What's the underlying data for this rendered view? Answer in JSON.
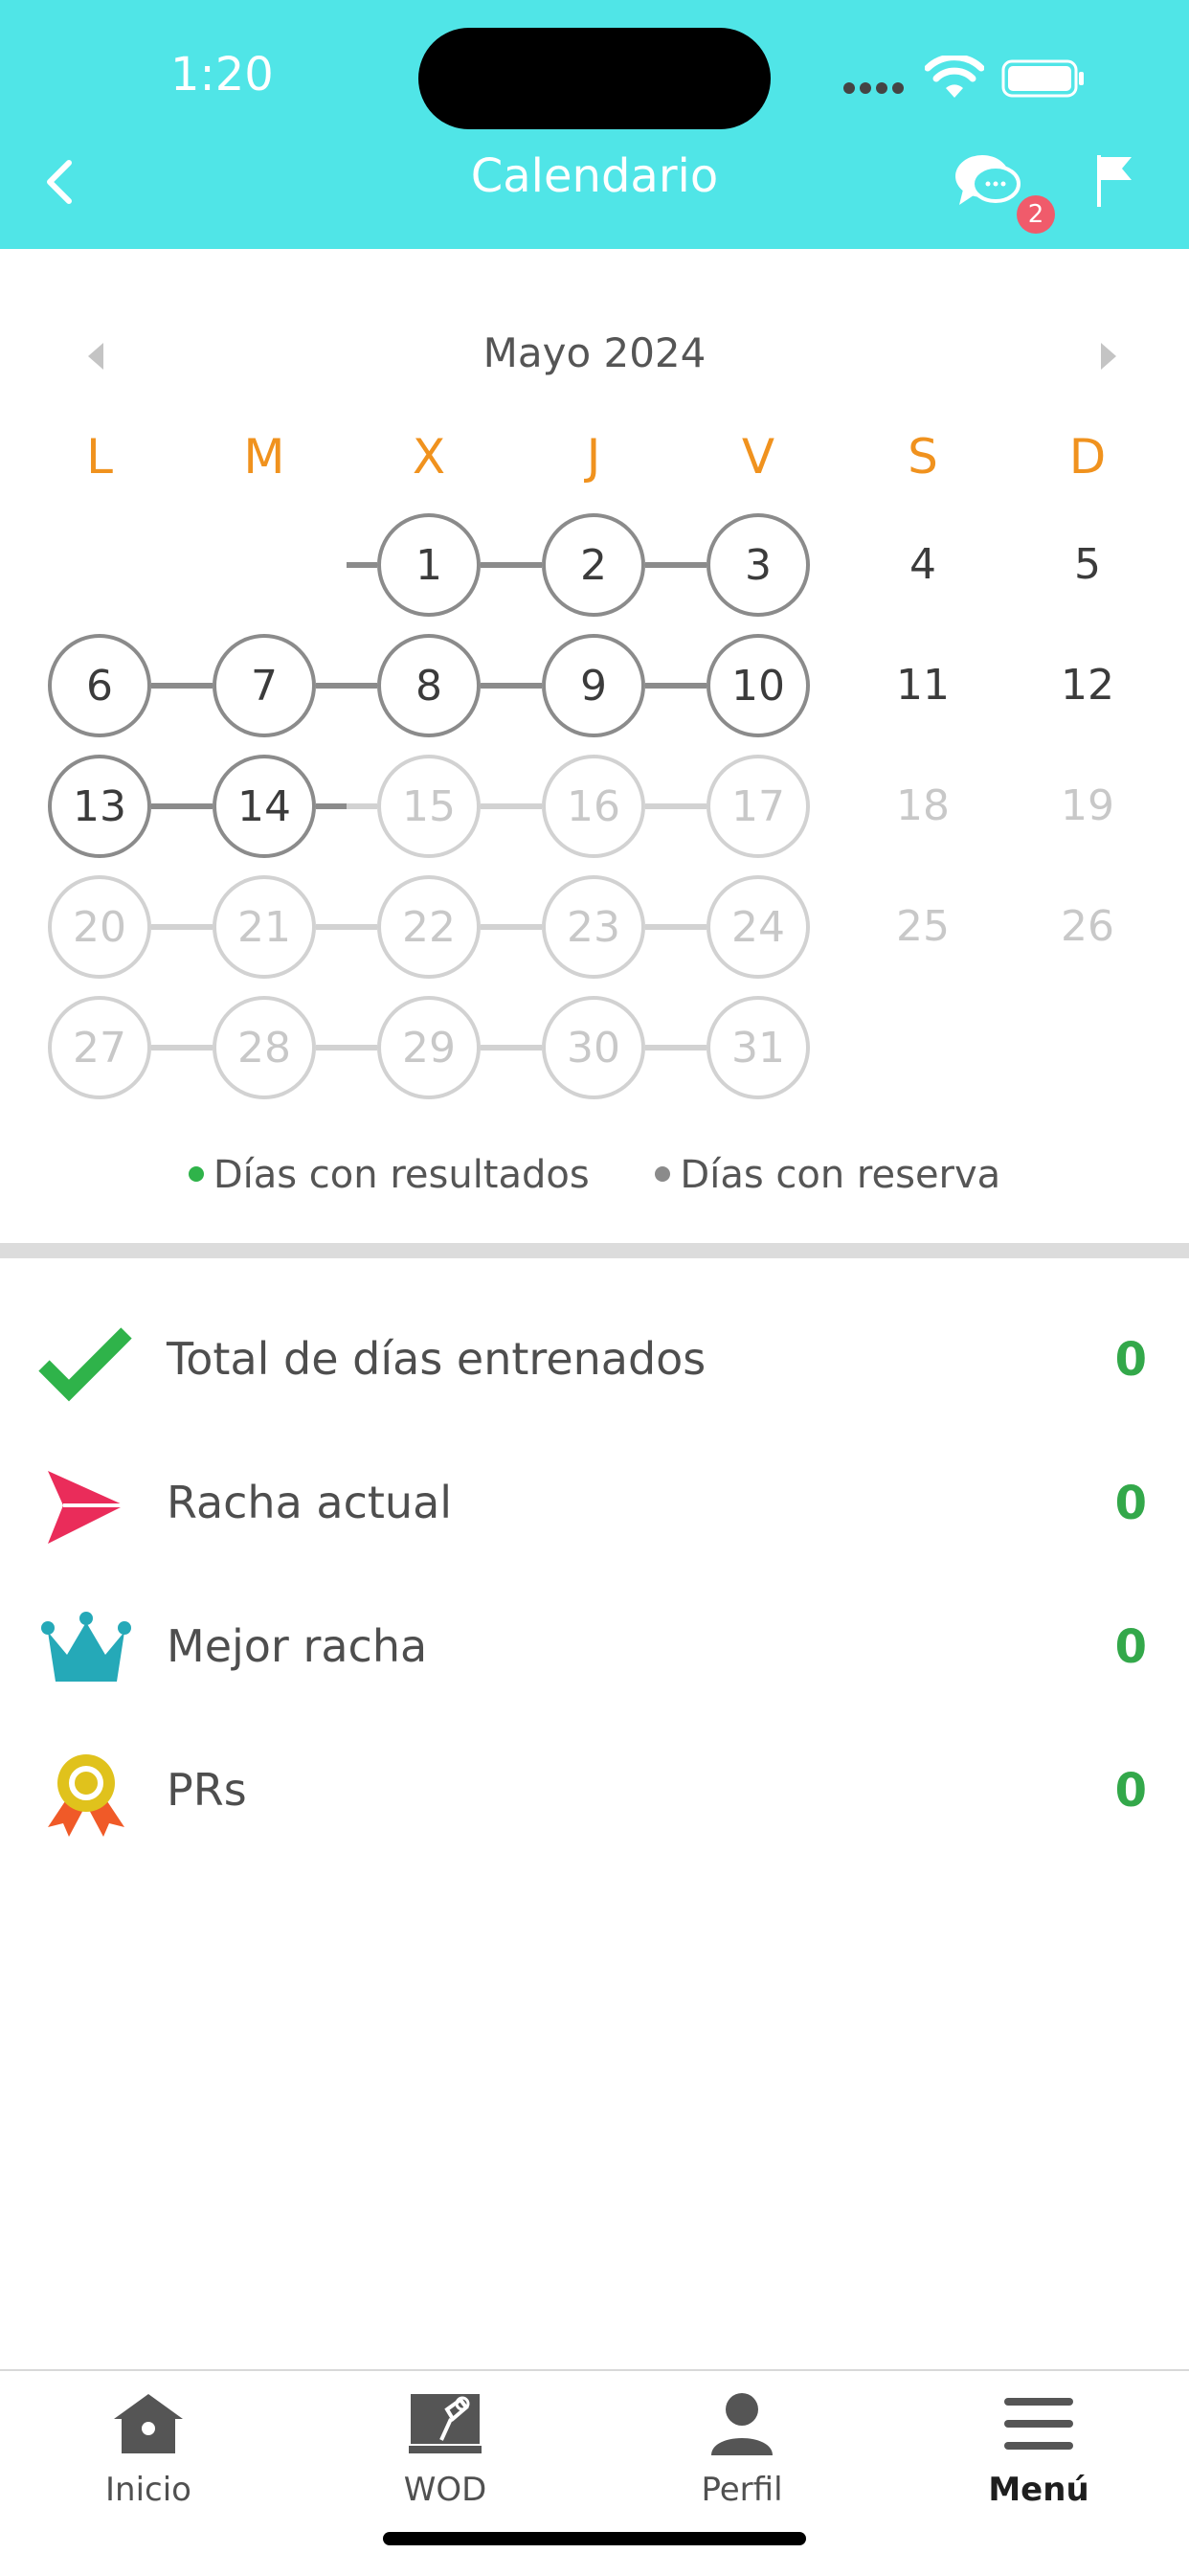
{
  "status_bar": {
    "time": "1:20"
  },
  "header": {
    "title": "Calendario",
    "chat_badge": "2"
  },
  "calendar": {
    "month_label": "Mayo 2024",
    "weekdays": [
      "L",
      "M",
      "X",
      "J",
      "V",
      "S",
      "D"
    ],
    "day_numbers": [
      "1",
      "2",
      "3",
      "4",
      "5",
      "6",
      "7",
      "8",
      "9",
      "10",
      "11",
      "12",
      "13",
      "14",
      "15",
      "16",
      "17",
      "18",
      "19",
      "20",
      "21",
      "22",
      "23",
      "24",
      "25",
      "26",
      "27",
      "28",
      "29",
      "30",
      "31"
    ],
    "active_through_day": 14,
    "first_weekday_index": 2
  },
  "legend": {
    "results_label": "Días con resultados",
    "booking_label": "Días con reserva",
    "results_color": "#2fb34a",
    "booking_color": "#8b8b8b"
  },
  "stats": [
    {
      "label": "Total de días entrenados",
      "value": "0",
      "icon": "checkmark-icon"
    },
    {
      "label": "Racha actual",
      "value": "0",
      "icon": "paper-plane-icon"
    },
    {
      "label": "Mejor racha",
      "value": "0",
      "icon": "crown-icon"
    },
    {
      "label": "PRs",
      "value": "0",
      "icon": "medal-icon"
    }
  ],
  "nav": [
    {
      "label": "Inicio",
      "icon": "home-icon"
    },
    {
      "label": "WOD",
      "icon": "whiteboard-icon"
    },
    {
      "label": "Perfil",
      "icon": "user-icon"
    },
    {
      "label": "Menú",
      "icon": "menu-icon"
    }
  ],
  "colors": {
    "header": "#50e5e7",
    "weekday": "#f0921e",
    "stat_value": "#33a84a"
  }
}
